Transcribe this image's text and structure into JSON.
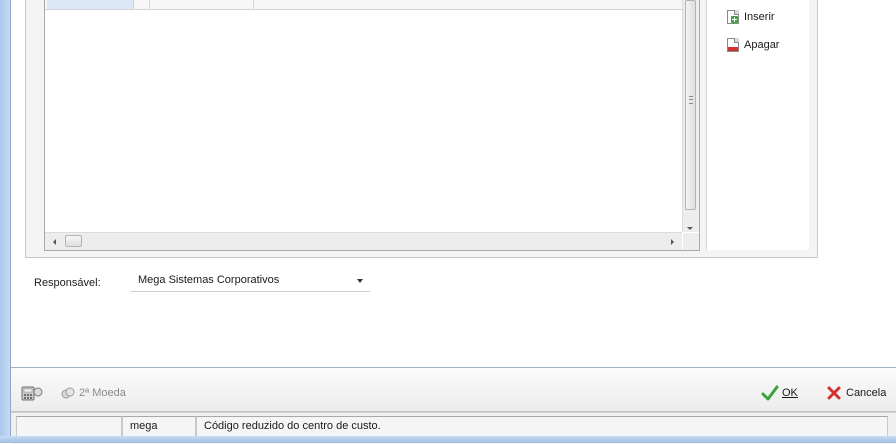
{
  "grid": {},
  "side_buttons": {
    "insert_label": "Inserir",
    "delete_label": "Apagar"
  },
  "responsible": {
    "label": "Responsável:",
    "value": "Mega Sistemas Corporativos"
  },
  "toolbar": {
    "currency_label": "2ª Moeda",
    "ok_label": "OK",
    "cancel_label": "Cancela"
  },
  "statusbar": {
    "user": "mega",
    "message": "Código reduzido do centro de custo."
  },
  "colors": {
    "ok_green": "#3aa33a",
    "cancel_red": "#d43030",
    "frame_blue": "#a9c7ea"
  },
  "icons": [
    "calculator-icon",
    "coin-icon",
    "insert-doc-icon",
    "delete-doc-icon",
    "check-icon",
    "x-icon"
  ]
}
